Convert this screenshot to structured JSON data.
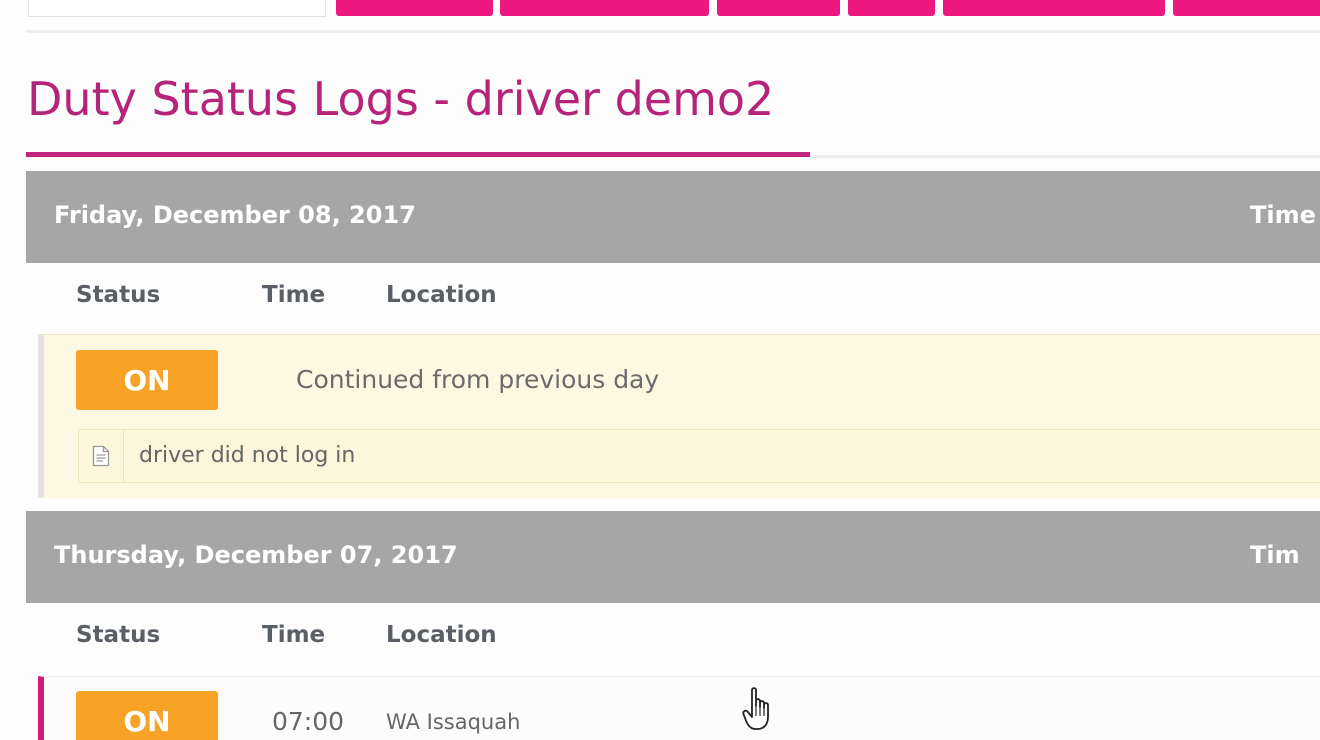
{
  "page": {
    "title": "Duty Status Logs - driver demo2"
  },
  "colors": {
    "accent": "#c2277f",
    "toolbar_button": "#ec177f",
    "day_header": "#a6a6a6",
    "status_on": "#f8a326",
    "row_highlight": "#fdf8e1"
  },
  "columns": {
    "status": "Status",
    "time": "Time",
    "location": "Location"
  },
  "days": [
    {
      "date": "Friday, December 08, 2017",
      "time_header": "Time",
      "entries": [
        {
          "status": "ON",
          "location": "Continued from previous day",
          "note": "driver did not log in",
          "note_icon": "document-icon"
        }
      ]
    },
    {
      "date": "Thursday, December 07, 2017",
      "time_header": "Tim",
      "entries": [
        {
          "status": "ON",
          "time": "07:00",
          "location": "WA Issaquah"
        }
      ]
    }
  ],
  "cursor": "hand-pointer-icon"
}
